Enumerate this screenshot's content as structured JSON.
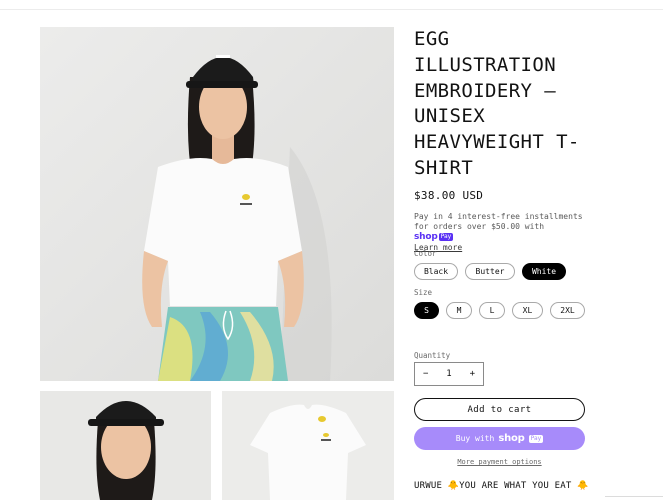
{
  "product": {
    "title": "EGG\nILLUSTRATION\nEMBROIDERY —\nUNISEX\nHEAVYWEIGHT T-\nSHIRT",
    "price": "$38.00 USD",
    "installments_text": "Pay in 4 interest-free installments for orders over $50.00 with",
    "learn_more": "Learn more",
    "shop_pay": {
      "word": "shop",
      "pay": "Pay"
    },
    "color_label": "Color",
    "colors": [
      {
        "label": "Black",
        "selected": false
      },
      {
        "label": "Butter",
        "selected": false
      },
      {
        "label": "White",
        "selected": true
      }
    ],
    "size_label": "Size",
    "sizes": [
      {
        "label": "S",
        "selected": true
      },
      {
        "label": "M",
        "selected": false
      },
      {
        "label": "L",
        "selected": false
      },
      {
        "label": "XL",
        "selected": false
      },
      {
        "label": "2XL",
        "selected": false
      }
    ],
    "quantity_label": "Quantity",
    "quantity": "1",
    "minus": "−",
    "plus": "+",
    "add_to_cart": "Add to cart",
    "buy_with": "Buy with",
    "more_payment_options": "More payment options",
    "description_start": "URWUE 🐥YOU ARE WHAT YOU EAT 🐥"
  },
  "colors": {
    "shop_pay": "#5a31f4",
    "shop_pay_button": "#a78bfa",
    "tee_white": "#fbfbfb",
    "cap_black": "#1b1b1b"
  }
}
